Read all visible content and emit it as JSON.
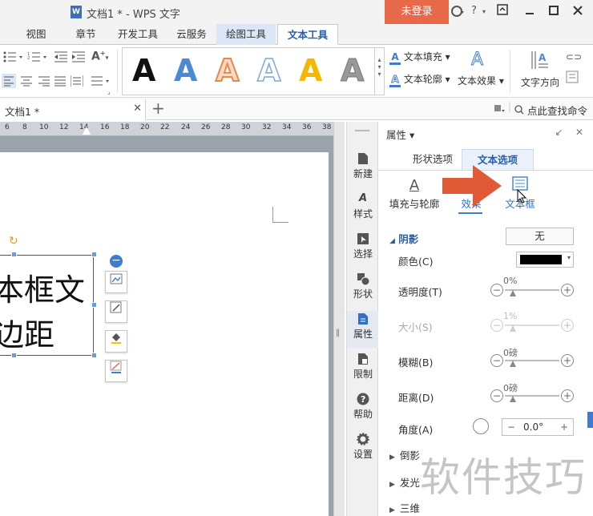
{
  "titlebar": {
    "doc_icon_text": "W",
    "title": "文档1 * - WPS 文字",
    "login_label": "未登录",
    "help_label": "?"
  },
  "menu": {
    "tabs": [
      {
        "label": "视图"
      },
      {
        "label": "章节"
      },
      {
        "label": "开发工具"
      },
      {
        "label": "云服务"
      },
      {
        "label": "绘图工具"
      },
      {
        "label": "文本工具"
      }
    ]
  },
  "ribbon": {
    "art_letter": "A",
    "text_fill": "文本填充",
    "text_outline": "文本轮廓",
    "text_effect": "文本效果",
    "text_direction": "文字方向"
  },
  "tabstrip": {
    "doc_tab_label": "文档1 *",
    "search_command": "点此查找命令"
  },
  "ruler": {
    "ticks": [
      "6",
      "8",
      "10",
      "12",
      "14",
      "16",
      "18",
      "20",
      "22",
      "24",
      "26",
      "28",
      "30",
      "32",
      "34",
      "36",
      "38"
    ]
  },
  "document": {
    "textbox_line1": "本框文",
    "textbox_line2": "边距"
  },
  "sidebar": {
    "items": [
      {
        "label": "新建",
        "icon": "new-doc-icon"
      },
      {
        "label": "样式",
        "icon": "style-icon"
      },
      {
        "label": "选择",
        "icon": "select-icon"
      },
      {
        "label": "形状",
        "icon": "shape-icon"
      },
      {
        "label": "属性",
        "icon": "properties-icon"
      },
      {
        "label": "限制",
        "icon": "restrict-icon"
      },
      {
        "label": "帮助",
        "icon": "help-icon"
      },
      {
        "label": "设置",
        "icon": "settings-icon"
      }
    ]
  },
  "panel": {
    "title": "属性",
    "option_tabs": [
      "形状选项",
      "文本选项"
    ],
    "sub_tabs": [
      "填充与轮廓",
      "效果",
      "文本框"
    ],
    "section_shadow": "阴影",
    "shadow_preset": "无",
    "color_label": "颜色(C)",
    "color_value": "#000000",
    "transparency_label": "透明度(T)",
    "transparency_value": "0%",
    "size_label": "大小(S)",
    "size_value": "1%",
    "blur_label": "模糊(B)",
    "blur_value": "0磅",
    "distance_label": "距离(D)",
    "distance_value": "0磅",
    "angle_label": "角度(A)",
    "angle_value": "0.0°",
    "collapsed": [
      "倒影",
      "发光",
      "三维"
    ]
  },
  "watermark": "软件技巧",
  "colors": {
    "accent": "#3f7ad3",
    "login_bg": "#e8694a",
    "arrow": "#e05a35"
  }
}
